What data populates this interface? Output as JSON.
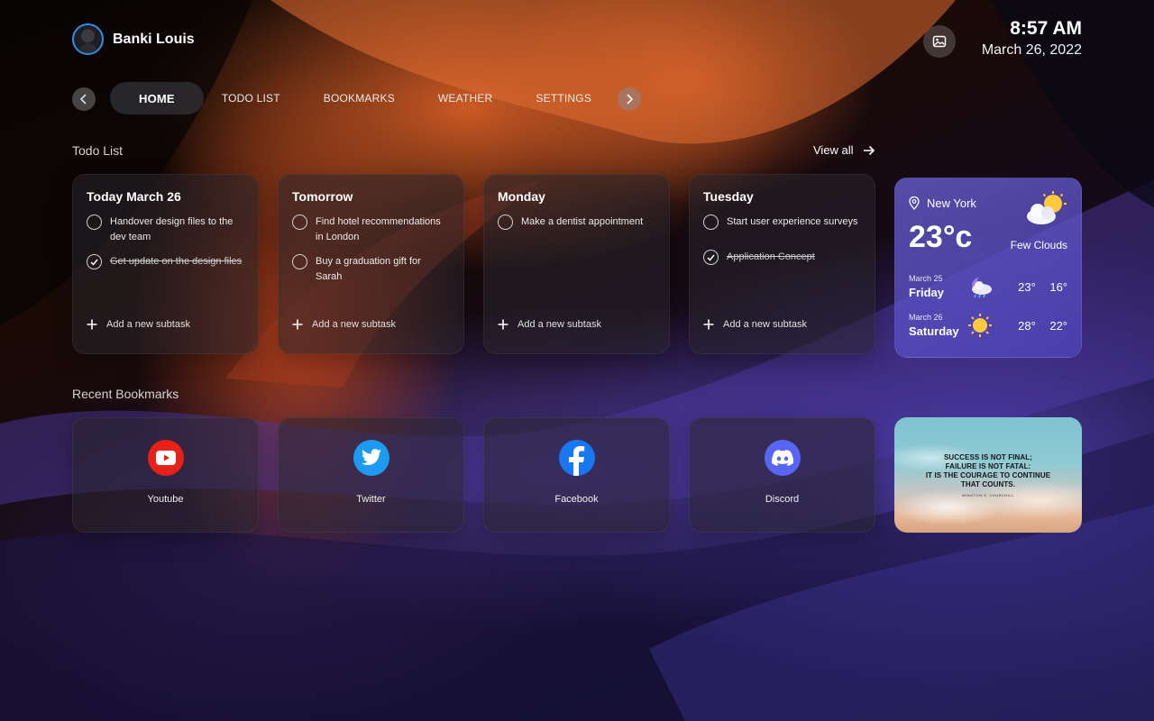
{
  "user": {
    "name": "Banki Louis"
  },
  "clock": {
    "time": "8:57 AM",
    "date": "March 26, 2022"
  },
  "nav": {
    "tabs": [
      {
        "label": "HOME",
        "active": true
      },
      {
        "label": "TODO LIST"
      },
      {
        "label": "BOOKMARKS"
      },
      {
        "label": "WEATHER"
      },
      {
        "label": "SETTINGS"
      }
    ]
  },
  "todo": {
    "section_title": "Todo List",
    "view_all": "View all",
    "add_label": "Add a new subtask",
    "cards": [
      {
        "title": "Today March 26",
        "items": [
          {
            "text": "Handover design files to the dev team",
            "done": false
          },
          {
            "text": "Get update on the design files",
            "done": true
          }
        ]
      },
      {
        "title": "Tomorrow",
        "items": [
          {
            "text": "Find hotel recommendations in London",
            "done": false
          },
          {
            "text": "Buy a graduation gift for Sarah",
            "done": false
          }
        ]
      },
      {
        "title": "Monday",
        "items": [
          {
            "text": "Make a dentist appointment",
            "done": false
          }
        ]
      },
      {
        "title": "Tuesday",
        "items": [
          {
            "text": "Start user experience surveys",
            "done": false
          },
          {
            "text": "Application Concept",
            "done": true
          }
        ]
      }
    ]
  },
  "weather": {
    "location": "New York",
    "temp": "23°c",
    "condition": "Few Clouds",
    "icon": "sun-cloud-icon",
    "forecast": [
      {
        "date": "March 25",
        "day": "Friday",
        "icon": "moon-rain-icon",
        "high": "23°",
        "low": "16°"
      },
      {
        "date": "March 26",
        "day": "Saturday",
        "icon": "sun-icon",
        "high": "28°",
        "low": "22°"
      }
    ]
  },
  "bookmarks": {
    "section_title": "Recent Bookmarks",
    "items": [
      {
        "label": "Youtube",
        "icon": "youtube-icon",
        "color": "#e62117"
      },
      {
        "label": "Twitter",
        "icon": "twitter-icon",
        "color": "#1d9bf0"
      },
      {
        "label": "Facebook",
        "icon": "facebook-icon",
        "color": "#1877f2"
      },
      {
        "label": "Discord",
        "icon": "discord-icon",
        "color": "#5865f2"
      }
    ]
  },
  "quote": {
    "text": "SUCCESS IS NOT FINAL;\nFAILURE IS NOT FATAL:\nIT IS THE COURAGE TO CONTINUE\nTHAT COUNTS.",
    "author": "WINSTON S. CHURCHILL"
  }
}
